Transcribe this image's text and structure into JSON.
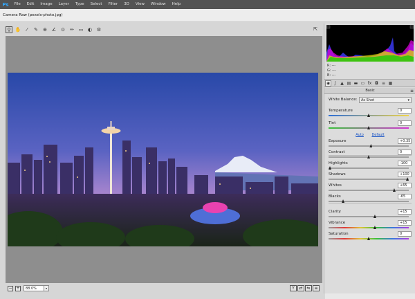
{
  "app": {
    "logo": "Ps",
    "menus": [
      "File",
      "Edit",
      "Image",
      "Layer",
      "Type",
      "Select",
      "Filter",
      "3D",
      "View",
      "Window",
      "Help"
    ]
  },
  "dialog": {
    "title": "Camera Raw (pexels-photo.jpg)"
  },
  "toolbar": {
    "tools": [
      "zoom-icon",
      "hand-icon",
      "white-balance-icon",
      "color-sampler-icon",
      "targeted-adjustment-icon",
      "straighten-icon",
      "red-eye-icon",
      "adjustment-brush-icon",
      "graduated-filter-icon",
      "radial-filter-icon",
      "preferences-icon"
    ]
  },
  "zoom": {
    "value": "88.0%"
  },
  "histogram": {
    "r_label": "R:",
    "r_val": "---",
    "g_label": "G:",
    "g_val": "---",
    "b_label": "B:",
    "b_val": "---"
  },
  "panel": {
    "section_title": "Basic",
    "white_balance": {
      "label": "White Balance:",
      "value": "As Shot"
    },
    "auto_label": "Auto",
    "default_label": "Default",
    "sliders": [
      {
        "label": "Temperature",
        "value": "0",
        "pos": 0.5,
        "gradient": "linear-gradient(90deg,#2f6fd6,#f1d54a)"
      },
      {
        "label": "Tint",
        "value": "0",
        "pos": 0.5,
        "gradient": "linear-gradient(90deg,#3ac23a,#d534d5)"
      },
      {
        "label": "Exposure",
        "value": "+0.35",
        "pos": 0.53,
        "gradient": ""
      },
      {
        "label": "Contrast",
        "value": "0",
        "pos": 0.5,
        "gradient": ""
      },
      {
        "label": "Highlights",
        "value": "-100",
        "pos": 0.0,
        "gradient": ""
      },
      {
        "label": "Shadows",
        "value": "+100",
        "pos": 1.0,
        "gradient": ""
      },
      {
        "label": "Whites",
        "value": "+65",
        "pos": 0.83,
        "gradient": ""
      },
      {
        "label": "Blacks",
        "value": "-65",
        "pos": 0.17,
        "gradient": ""
      },
      {
        "label": "Clarity",
        "value": "+15",
        "pos": 0.58,
        "gradient": ""
      },
      {
        "label": "Vibrance",
        "value": "+15",
        "pos": 0.58,
        "gradient": "linear-gradient(90deg,#9a9a9a,#e03838,#e0c438,#38c038,#3878e0,#b038e0)"
      },
      {
        "label": "Saturation",
        "value": "0",
        "pos": 0.5,
        "gradient": "linear-gradient(90deg,#9a9a9a,#e03838,#e0c438,#38c038,#3878e0,#b038e0)"
      }
    ]
  }
}
